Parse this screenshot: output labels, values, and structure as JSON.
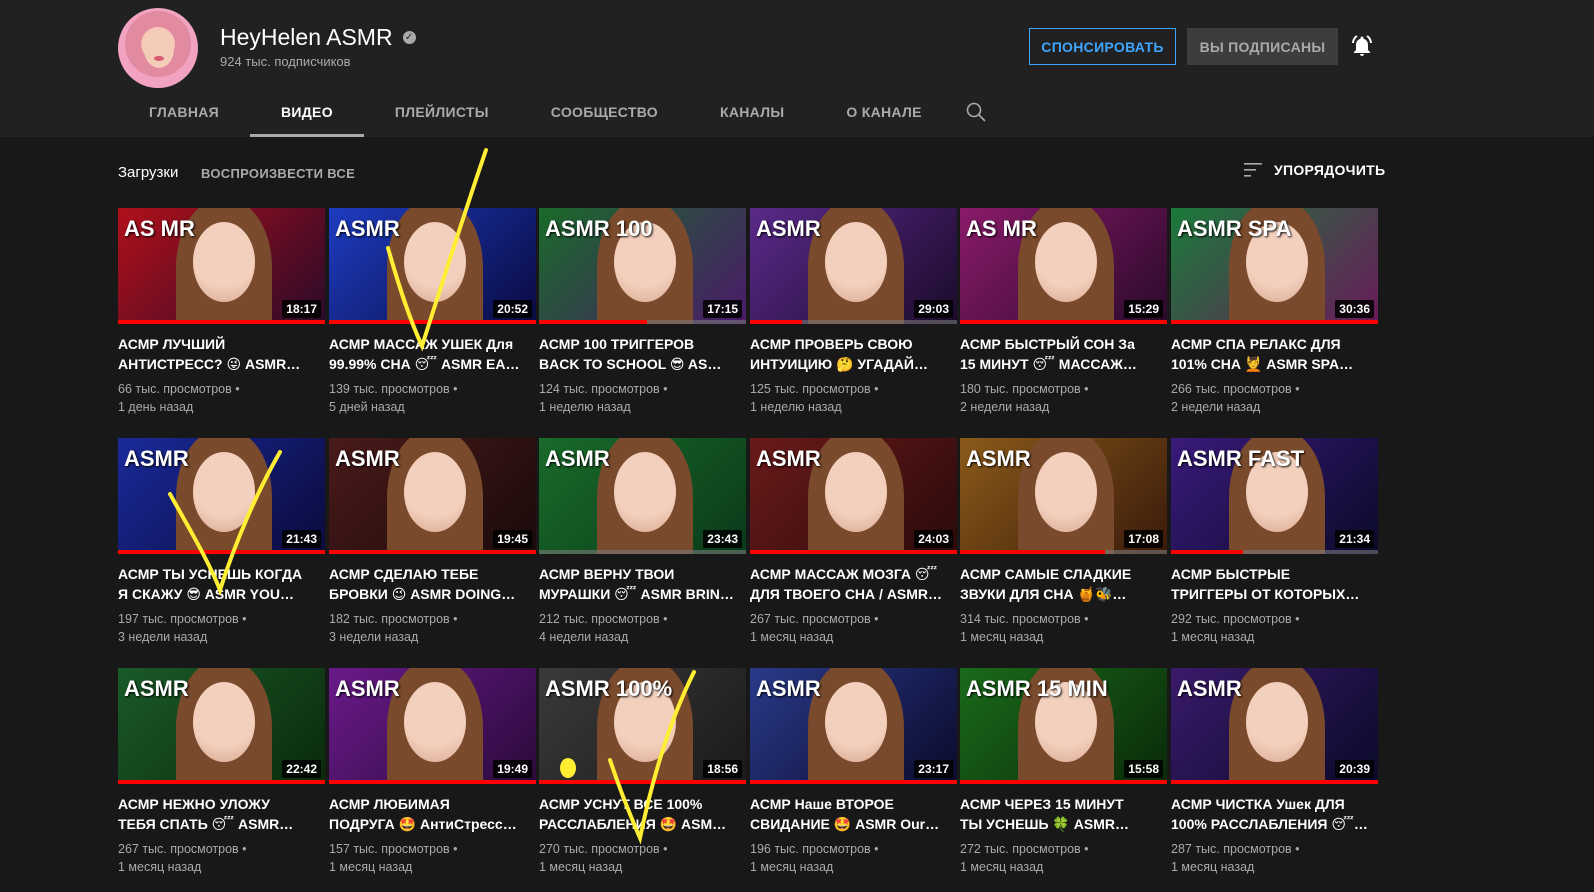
{
  "channel": {
    "name": "HeyHelen ASMR",
    "subscribers": "924 тыс. подписчиков",
    "sponsor_label": "СПОНСИРОВАТЬ",
    "subscribed_label": "ВЫ ПОДПИСАНЫ"
  },
  "tabs": [
    {
      "label": "ГЛАВНАЯ",
      "active": false
    },
    {
      "label": "ВИДЕО",
      "active": true
    },
    {
      "label": "ПЛЕЙЛИСТЫ",
      "active": false
    },
    {
      "label": "СООБЩЕСТВО",
      "active": false
    },
    {
      "label": "КАНАЛЫ",
      "active": false
    },
    {
      "label": "О КАНАЛЕ",
      "active": false
    }
  ],
  "section": {
    "title": "Загрузки",
    "play_all": "ВОСПРОИЗВЕСТИ ВСЕ",
    "sort_label": "УПОРЯДОЧИТЬ"
  },
  "colors": {
    "accent_blue": "#3ea6ff",
    "progress_red": "#ff0000",
    "annotation_yellow": "#ffee33"
  },
  "videos": [
    {
      "line1": "АСМР ЛУЧШИЙ",
      "line2": "АНТИСТРЕСС? 😜 ASMR…",
      "views": "66 тыс. просмотров",
      "age": "1 день назад",
      "duration": "18:17",
      "watched": 1.0,
      "bg": [
        "#b0101a",
        "#2a0a2a"
      ],
      "tag": "AS MR"
    },
    {
      "line1": "АСМР МАССАЖ УШЕК Для",
      "line2": "99.99% СНА 😴 ASMR EA…",
      "views": "139 тыс. просмотров",
      "age": "5 дней назад",
      "duration": "20:52",
      "watched": 1.0,
      "bg": [
        "#1d3cc0",
        "#0a0a40"
      ],
      "tag": "ASMR"
    },
    {
      "line1": "АСМР 100 ТРИГГЕРОВ",
      "line2": "BACK TO SCHOOL 😎 AS…",
      "views": "124 тыс. просмотров",
      "age": "1 неделю назад",
      "duration": "17:15",
      "watched": 0.52,
      "bg": [
        "#1a6a2a",
        "#4a1a6a"
      ],
      "tag": "ASMR 100"
    },
    {
      "line1": "АСМР ПРОВЕРЬ СВОЮ",
      "line2": "ИНТУИЦИЮ 🤔 УГАДАЙ…",
      "views": "125 тыс. просмотров",
      "age": "1 неделю назад",
      "duration": "29:03",
      "watched": 0.25,
      "bg": [
        "#5a2a8a",
        "#1a0a2a"
      ],
      "tag": "ASMR"
    },
    {
      "line1": "АСМР БЫСТРЫЙ СОН За",
      "line2": "15 МИНУТ 😴 МАССАЖ…",
      "views": "180 тыс. просмотров",
      "age": "2 недели назад",
      "duration": "15:29",
      "watched": 1.0,
      "bg": [
        "#8a1a6a",
        "#2a0a2a"
      ],
      "tag": "AS MR"
    },
    {
      "line1": "АСМР СПА РЕЛАКС ДЛЯ",
      "line2": "101% СНА 💆 ASMR SPA…",
      "views": "266 тыс. просмотров",
      "age": "2 недели назад",
      "duration": "30:36",
      "watched": 1.0,
      "bg": [
        "#1a7a3a",
        "#6a1a5a"
      ],
      "tag": "ASMR SPA"
    },
    {
      "line1": "АСМР ТЫ УСНЕШЬ КОГДА",
      "line2": "Я СКАЖУ 😎 ASMR YOU…",
      "views": "197 тыс. просмотров",
      "age": "3 недели назад",
      "duration": "21:43",
      "watched": 1.0,
      "bg": [
        "#1a2a9a",
        "#0a0a3a"
      ],
      "tag": "ASMR"
    },
    {
      "line1": "АСМР СДЕЛАЮ ТЕБЕ",
      "line2": "БРОВКИ 😉 ASMR DOING…",
      "views": "182 тыс. просмотров",
      "age": "3 недели назад",
      "duration": "19:45",
      "watched": 1.0,
      "bg": [
        "#4a1a1a",
        "#1a0a0a"
      ],
      "tag": "ASMR"
    },
    {
      "line1": "АСМР ВЕРНУ ТВОИ",
      "line2": "МУРАШКИ 😴 ASMR BRIN…",
      "views": "212 тыс. просмотров",
      "age": "4 недели назад",
      "duration": "23:43",
      "watched": 0.0,
      "bg": [
        "#1a6a2a",
        "#0a3a1a"
      ],
      "tag": "ASMR"
    },
    {
      "line1": "АСМР МАССАЖ МОЗГА 😴",
      "line2": "ДЛЯ ТВОЕГО СНА / ASMR…",
      "views": "267 тыс. просмотров",
      "age": "1 месяц назад",
      "duration": "24:03",
      "watched": 1.0,
      "bg": [
        "#6a1a1a",
        "#2a0a0a"
      ],
      "tag": "ASMR"
    },
    {
      "line1": "АСМР САМЫЕ СЛАДКИЕ",
      "line2": "ЗВУКИ ДЛЯ СНА 🍯🐝…",
      "views": "314 тыс. просмотров",
      "age": "1 месяц назад",
      "duration": "17:08",
      "watched": 0.7,
      "bg": [
        "#8a5a1a",
        "#3a1a0a"
      ],
      "tag": "ASMR"
    },
    {
      "line1": "АСМР БЫСТРЫЕ",
      "line2": "ТРИГГЕРЫ ОТ КОТОРЫХ…",
      "views": "292 тыс. просмотров",
      "age": "1 месяц назад",
      "duration": "21:34",
      "watched": 0.35,
      "bg": [
        "#3a1a7a",
        "#0a0a2a"
      ],
      "tag": "ASMR FAST"
    },
    {
      "line1": "АСМР НЕЖНО УЛОЖУ",
      "line2": "ТЕБЯ СПАТЬ 😴 ASMR…",
      "views": "267 тыс. просмотров",
      "age": "1 месяц назад",
      "duration": "22:42",
      "watched": 1.0,
      "bg": [
        "#1a5a2a",
        "#0a2a0a"
      ],
      "tag": "ASMR"
    },
    {
      "line1": "АСМР ЛЮБИМАЯ",
      "line2": "ПОДРУГА 🤩 АнтиСтресс…",
      "views": "157 тыс. просмотров",
      "age": "1 месяц назад",
      "duration": "19:49",
      "watched": 1.0,
      "bg": [
        "#6a1a8a",
        "#2a0a3a"
      ],
      "tag": "ASMR"
    },
    {
      "line1": "АСМР УСНУТ ВСЕ 100%",
      "line2": "РАССЛАБЛЕНИЯ 🤩 ASM…",
      "views": "270 тыс. просмотров",
      "age": "1 месяц назад",
      "duration": "18:56",
      "watched": 1.0,
      "bg": [
        "#3a3a3a",
        "#1a1a1a"
      ],
      "tag": "ASMR 100%"
    },
    {
      "line1": "АСМР Наше ВТОРОЕ",
      "line2": "СВИДАНИЕ 🤩 ASMR Our…",
      "views": "196 тыс. просмотров",
      "age": "1 месяц назад",
      "duration": "23:17",
      "watched": 1.0,
      "bg": [
        "#2a3a8a",
        "#0a0a2a"
      ],
      "tag": "ASMR"
    },
    {
      "line1": "АСМР ЧЕРЕЗ 15 МИНУТ",
      "line2": "ТЫ УСНЕШЬ 🍀 ASMR…",
      "views": "272 тыс. просмотров",
      "age": "1 месяц назад",
      "duration": "15:58",
      "watched": 1.0,
      "bg": [
        "#1a6a1a",
        "#0a2a0a"
      ],
      "tag": "ASMR 15 MIN"
    },
    {
      "line1": "АСМР ЧИСТКА Ушек ДЛЯ",
      "line2": "100% РАССЛАБЛЕНИЯ 😴…",
      "views": "287 тыс. просмотров",
      "age": "1 месяц назад",
      "duration": "20:39",
      "watched": 1.0,
      "bg": [
        "#3a1a6a",
        "#0a0a2a"
      ],
      "tag": "ASMR"
    }
  ]
}
